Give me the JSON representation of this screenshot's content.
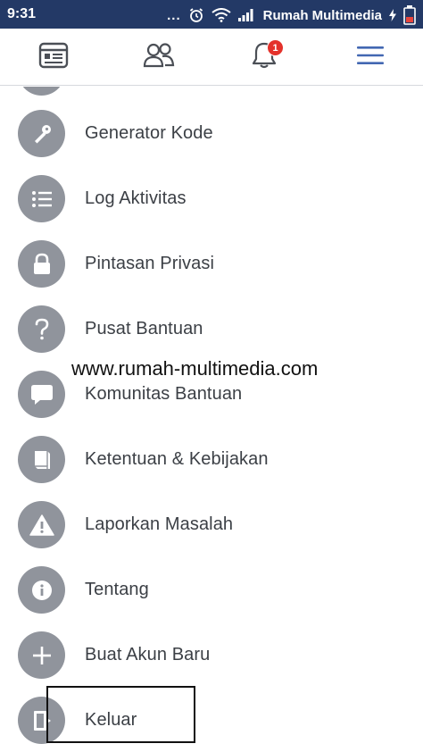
{
  "status_bar": {
    "time": "9:31",
    "dots": "...",
    "carrier": "Rumah Multimedia",
    "background_color": "#233966"
  },
  "top_nav": {
    "icons": [
      "news-feed-icon",
      "friends-icon",
      "notifications-icon",
      "hamburger-menu-icon"
    ],
    "notification_badge": "1",
    "active_color": "#4267b2"
  },
  "menu": {
    "items": [
      {
        "label": "Generator Kode",
        "icon": "key-icon"
      },
      {
        "label": "Log Aktivitas",
        "icon": "list-icon"
      },
      {
        "label": "Pintasan Privasi",
        "icon": "lock-icon"
      },
      {
        "label": "Pusat Bantuan",
        "icon": "question-icon"
      },
      {
        "label": "Komunitas Bantuan",
        "icon": "speech-bubble-icon"
      },
      {
        "label": "Ketentuan & Kebijakan",
        "icon": "book-icon"
      },
      {
        "label": "Laporkan Masalah",
        "icon": "warning-icon"
      },
      {
        "label": "Tentang",
        "icon": "info-icon"
      },
      {
        "label": "Buat Akun Baru",
        "icon": "plus-icon"
      },
      {
        "label": "Keluar",
        "icon": "logout-icon"
      }
    ],
    "icon_circle_color": "#90949c"
  },
  "watermark": "www.rumah-multimedia.com"
}
